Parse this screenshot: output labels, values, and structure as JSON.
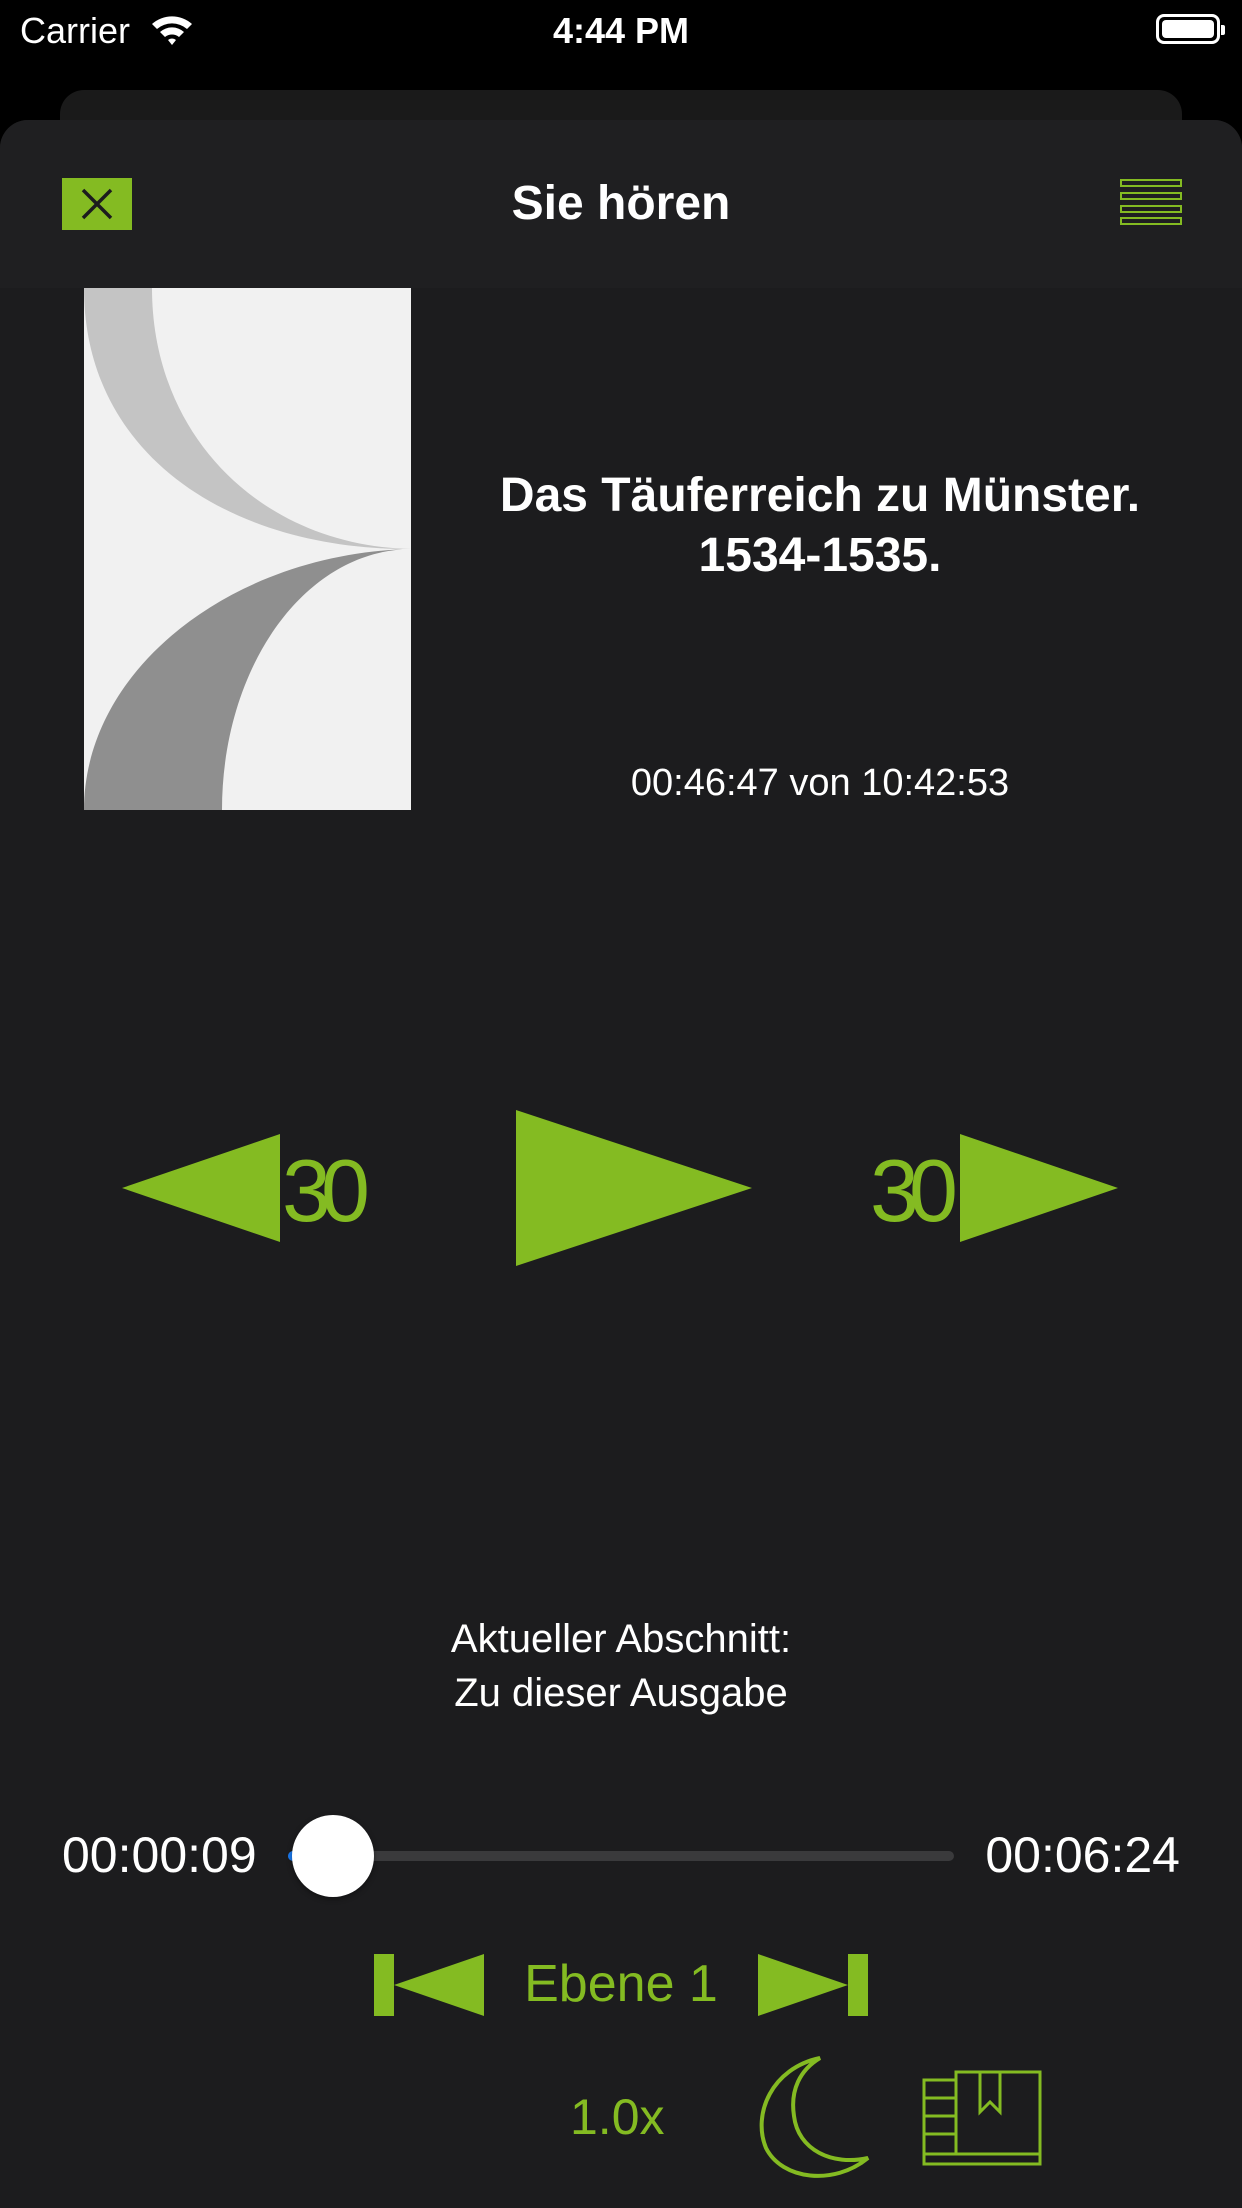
{
  "status_bar": {
    "carrier": "Carrier",
    "time": "4:44 PM"
  },
  "header": {
    "title": "Sie hören",
    "close_icon": "close-icon",
    "menu_icon": "menu-icon"
  },
  "book": {
    "title_line1": "Das Täuferreich zu Münster.",
    "title_line2": "1534-1535.",
    "progress": "00:46:47 von 10:42:53"
  },
  "controls": {
    "skip_back_seconds": "30",
    "skip_forward_seconds": "30"
  },
  "section": {
    "label": "Aktueller Abschnitt:",
    "name": "Zu dieser Ausgabe"
  },
  "scrubber": {
    "elapsed": "00:00:09",
    "remaining": "00:06:24",
    "position_fraction": 0.023
  },
  "chapter_nav": {
    "level": "Ebene 1"
  },
  "footer": {
    "speed": "1.0x"
  },
  "colors": {
    "accent": "#84bb22",
    "background": "#1c1c1e",
    "slider_fill": "#1a7cf5"
  }
}
